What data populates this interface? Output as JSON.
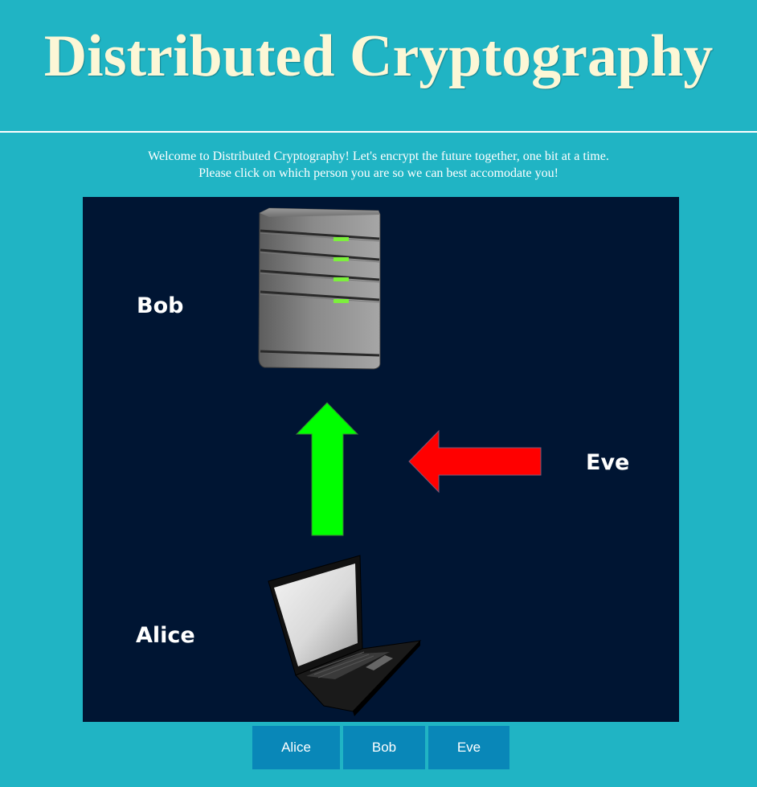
{
  "header": {
    "title": "Distributed Cryptography"
  },
  "intro": {
    "line1": "Welcome to Distributed Cryptography! Let's encrypt the future together, one bit at a time.",
    "line2": "Please click on which person you are so we can best accomodate you!"
  },
  "diagram": {
    "labels": {
      "bob": "Bob",
      "eve": "Eve",
      "alice": "Alice"
    },
    "icons": {
      "bob": "server-icon",
      "alice": "laptop-icon",
      "alice_to_bob": "arrow-up-icon",
      "eve_intercept": "arrow-left-icon"
    },
    "colors": {
      "background": "#001533",
      "alice_to_bob_arrow": "#00ff00",
      "eve_arrow": "#ff0000"
    }
  },
  "buttons": {
    "alice": "Alice",
    "bob": "Bob",
    "eve": "Eve"
  },
  "colors": {
    "page_background": "#20b4c4",
    "title": "#fcf7d6",
    "button": "#0987b8"
  }
}
